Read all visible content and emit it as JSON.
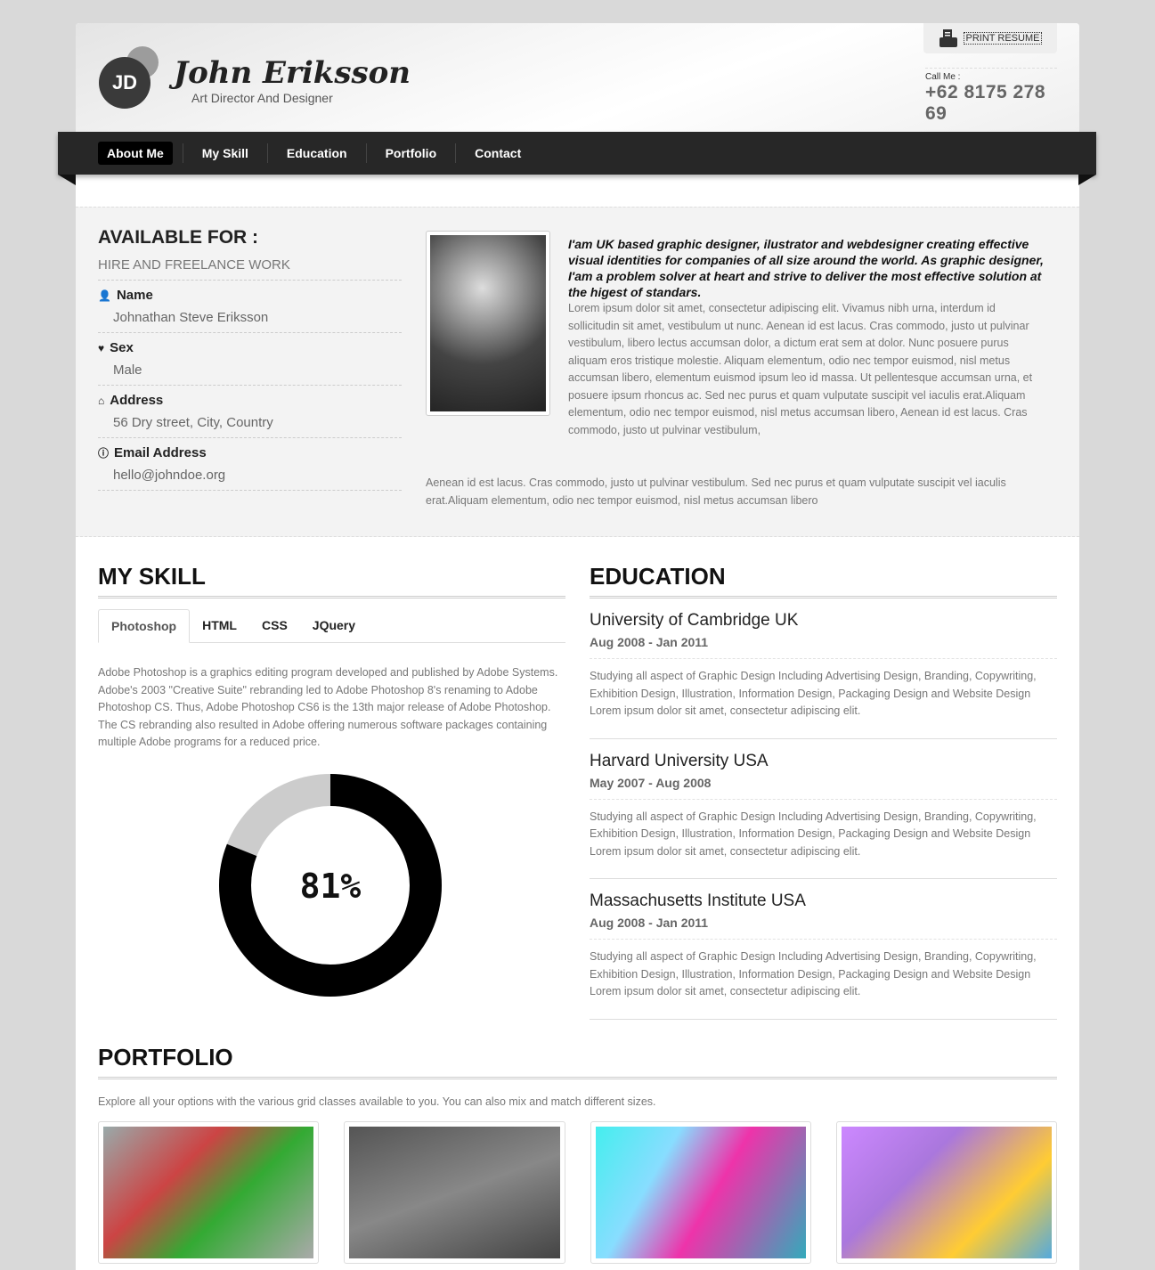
{
  "header": {
    "logo_initials": "JD",
    "name": "John Eriksson",
    "role": "Art Director And Designer",
    "print_label": "PRINT RESUME",
    "call_label": "Call Me :",
    "phone": "+62 8175 278 69"
  },
  "nav": [
    {
      "label": "About Me",
      "active": true
    },
    {
      "label": "My Skill"
    },
    {
      "label": "Education"
    },
    {
      "label": "Portfolio"
    },
    {
      "label": "Contact"
    }
  ],
  "about": {
    "title": "AVAILABLE FOR :",
    "subtitle": "HIRE AND FREELANCE WORK",
    "fields": [
      {
        "icon": "user-icon",
        "label": "Name",
        "value": "Johnathan Steve Eriksson"
      },
      {
        "icon": "heart-icon",
        "label": "Sex",
        "value": "Male"
      },
      {
        "icon": "home-icon",
        "label": "Address",
        "value": "56 Dry street, City, Country"
      },
      {
        "icon": "info-icon",
        "label": "Email Address",
        "value": "hello@johndoe.org"
      }
    ],
    "lead": "I'am UK based graphic designer, ilustrator and webdesigner creating effective visual identities for companies of all size around the world. As graphic designer, I'am a problem solver at heart and strive to deliver the most effective solution at the higest of standars.",
    "para1": "Lorem ipsum dolor sit amet, consectetur adipiscing elit. Vivamus nibh urna, interdum id sollicitudin sit amet, vestibulum ut nunc. Aenean id est lacus. Cras commodo, justo ut pulvinar vestibulum, libero lectus accumsan dolor, a dictum erat sem at dolor. Nunc posuere purus aliquam eros tristique molestie. Aliquam elementum, odio nec tempor euismod, nisl metus accumsan libero, elementum euismod ipsum leo id massa. Ut pellentesque accumsan urna, et posuere ipsum rhoncus ac. Sed nec purus et quam vulputate suscipit vel iaculis erat.Aliquam elementum, odio nec tempor euismod, nisl metus accumsan libero, Aenean id est lacus. Cras commodo, justo ut pulvinar vestibulum,",
    "para2": "Aenean id est lacus. Cras commodo, justo ut pulvinar vestibulum. Sed nec purus et quam vulputate suscipit vel iaculis erat.Aliquam elementum, odio nec tempor euismod, nisl metus accumsan libero"
  },
  "skill": {
    "title": "MY SKILL",
    "tabs": [
      "Photoshop",
      "HTML",
      "CSS",
      "JQuery"
    ],
    "active_tab": "Photoshop",
    "text": "Adobe Photoshop is a graphics editing program developed and published by Adobe Systems. Adobe's 2003 \"Creative Suite\" rebranding led to Adobe Photoshop 8's renaming to Adobe Photoshop CS. Thus, Adobe Photoshop CS6 is the 13th major release of Adobe Photoshop. The CS rebranding also resulted in Adobe offering numerous software packages containing multiple Adobe programs for a reduced price.",
    "percent": 81,
    "percent_label": "81%",
    "colors": {
      "fill": "#000000",
      "track": "#cccccc"
    }
  },
  "education": {
    "title": "EDUCATION",
    "items": [
      {
        "school": "University of Cambridge UK",
        "dates": "Aug 2008 - Jan 2011",
        "text": "Studying all aspect of Graphic Design Including Advertising Design, Branding, Copywriting, Exhibition Design, Illustration, Information Design, Packaging Design and Website Design Lorem ipsum dolor sit amet, consectetur adipiscing elit."
      },
      {
        "school": "Harvard University USA",
        "dates": "May 2007 - Aug 2008",
        "text": "Studying all aspect of Graphic Design Including Advertising Design, Branding, Copywriting, Exhibition Design, Illustration, Information Design, Packaging Design and Website Design Lorem ipsum dolor sit amet, consectetur adipiscing elit."
      },
      {
        "school": "Massachusetts Institute USA",
        "dates": "Aug 2008 - Jan 2011",
        "text": "Studying all aspect of Graphic Design Including Advertising Design, Branding, Copywriting, Exhibition Design, Illustration, Information Design, Packaging Design and Website Design Lorem ipsum dolor sit amet, consectetur adipiscing elit."
      }
    ]
  },
  "portfolio": {
    "title": "PORTFOLIO",
    "text": "Explore all your options with the various grid classes available to you. You can also mix and match different sizes."
  }
}
